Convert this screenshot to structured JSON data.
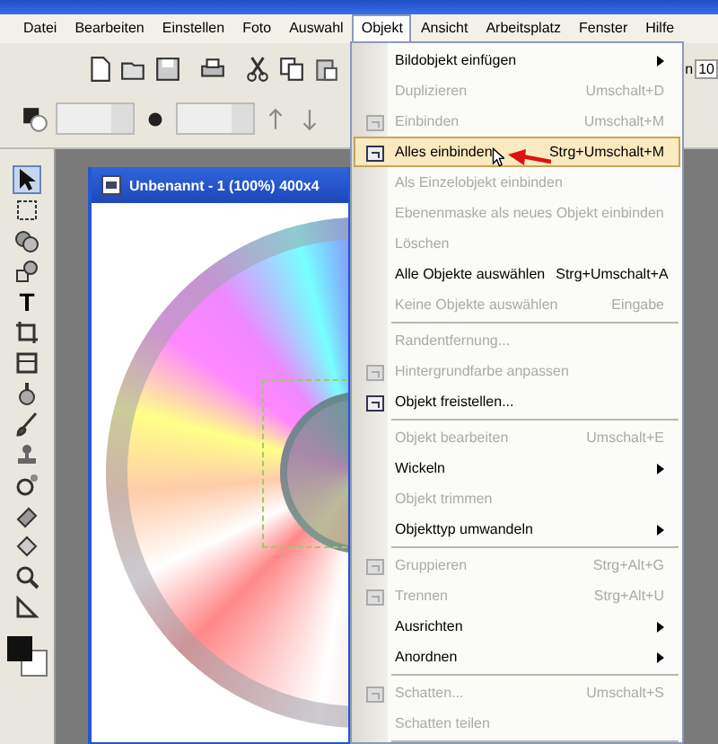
{
  "menu_bar": [
    {
      "label": "Datei",
      "selected": false
    },
    {
      "label": "Bearbeiten",
      "selected": false
    },
    {
      "label": "Einstellen",
      "selected": false
    },
    {
      "label": "Foto",
      "selected": false
    },
    {
      "label": "Auswahl",
      "selected": false
    },
    {
      "label": "Objekt",
      "selected": true
    },
    {
      "label": "Ansicht",
      "selected": false
    },
    {
      "label": "Arbeitsplatz",
      "selected": false
    },
    {
      "label": "Fenster",
      "selected": false
    },
    {
      "label": "Hilfe",
      "selected": false
    }
  ],
  "toolbar": {
    "zoom_label": "n",
    "zoom_value": "10"
  },
  "toolbox": {
    "text_tool": "T"
  },
  "document": {
    "title": "Unbenannt - 1 (100%) 400x4"
  },
  "menu": [
    {
      "kind": "item",
      "label": "Bildobjekt einfügen",
      "disabled": false,
      "submenu": true,
      "selected": false
    },
    {
      "kind": "item",
      "label": "Duplizieren",
      "shortcut": "Umschalt+D",
      "disabled": true,
      "selected": false
    },
    {
      "kind": "item",
      "label": "Einbinden",
      "shortcut": "Umschalt+M",
      "disabled": true,
      "icon": true,
      "selected": false
    },
    {
      "kind": "item",
      "label": "Alles einbinden",
      "shortcut": "Strg+Umschalt+M",
      "disabled": false,
      "icon": true,
      "selected": true
    },
    {
      "kind": "item",
      "label": "Als Einzelobjekt einbinden",
      "disabled": true,
      "selected": false
    },
    {
      "kind": "item",
      "label": "Ebenenmaske als neues Objekt einbinden",
      "disabled": true,
      "selected": false
    },
    {
      "kind": "item",
      "label": "Löschen",
      "disabled": true,
      "selected": false
    },
    {
      "kind": "item",
      "label": "Alle Objekte auswählen",
      "shortcut": "Strg+Umschalt+A",
      "disabled": false,
      "selected": false
    },
    {
      "kind": "item",
      "label": "Keine Objekte auswählen",
      "shortcut": "Eingabe",
      "disabled": true,
      "selected": false
    },
    {
      "kind": "separator"
    },
    {
      "kind": "item",
      "label": "Randentfernung...",
      "disabled": true,
      "selected": false
    },
    {
      "kind": "item",
      "label": "Hintergrundfarbe anpassen",
      "disabled": true,
      "icon": true,
      "selected": false
    },
    {
      "kind": "item",
      "label": "Objekt freistellen...",
      "disabled": false,
      "icon": true,
      "selected": false
    },
    {
      "kind": "separator"
    },
    {
      "kind": "item",
      "label": "Objekt bearbeiten",
      "shortcut": "Umschalt+E",
      "disabled": true,
      "selected": false
    },
    {
      "kind": "item",
      "label": "Wickeln",
      "disabled": false,
      "submenu": true,
      "selected": false
    },
    {
      "kind": "item",
      "label": "Objekt trimmen",
      "disabled": true,
      "selected": false
    },
    {
      "kind": "item",
      "label": "Objekttyp umwandeln",
      "disabled": false,
      "submenu": true,
      "selected": false
    },
    {
      "kind": "separator"
    },
    {
      "kind": "item",
      "label": "Gruppieren",
      "shortcut": "Strg+Alt+G",
      "disabled": true,
      "icon": true,
      "selected": false
    },
    {
      "kind": "item",
      "label": "Trennen",
      "shortcut": "Strg+Alt+U",
      "disabled": true,
      "icon": true,
      "selected": false
    },
    {
      "kind": "item",
      "label": "Ausrichten",
      "disabled": false,
      "submenu": true,
      "selected": false
    },
    {
      "kind": "item",
      "label": "Anordnen",
      "disabled": false,
      "submenu": true,
      "selected": false
    },
    {
      "kind": "separator"
    },
    {
      "kind": "item",
      "label": "Schatten...",
      "shortcut": "Umschalt+S",
      "disabled": true,
      "icon": true,
      "selected": false
    },
    {
      "kind": "item",
      "label": "Schatten teilen",
      "disabled": true,
      "selected": false
    },
    {
      "kind": "separator"
    }
  ]
}
